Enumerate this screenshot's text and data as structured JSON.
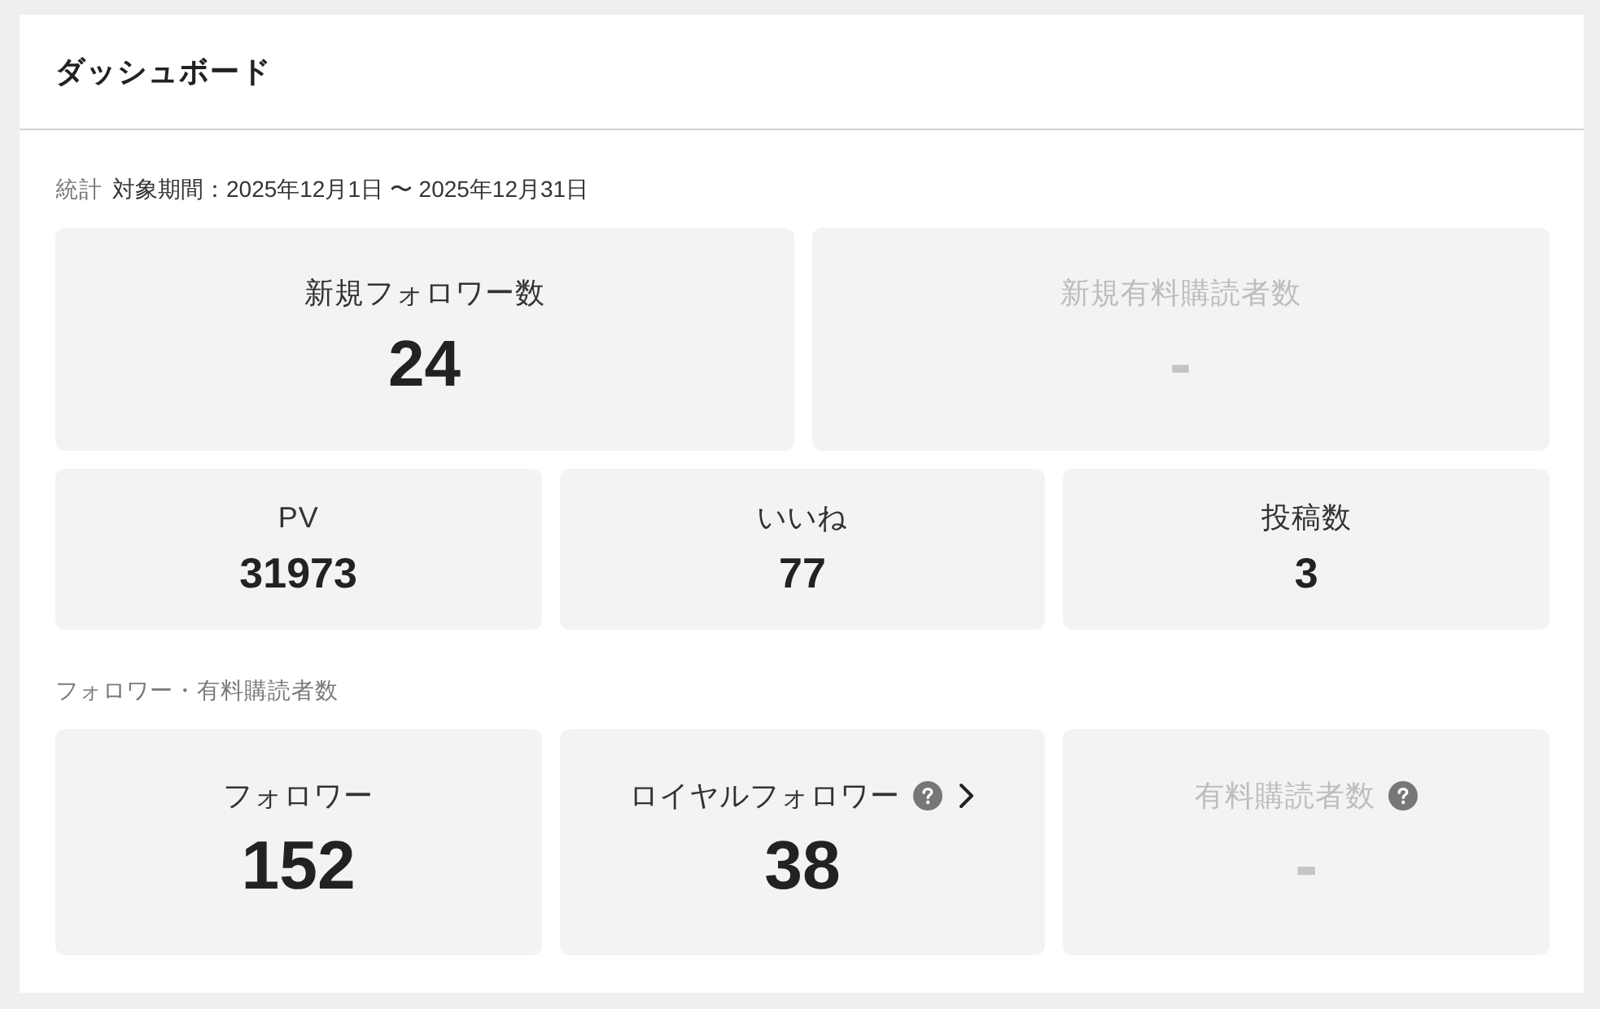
{
  "header": {
    "title": "ダッシュボード"
  },
  "sections": [
    {
      "label": "統計",
      "period": "対象期間：2025年12月1日 〜 2025年12月31日",
      "rows": [
        {
          "kind": "large",
          "tiles": [
            {
              "label": "新規フォロワー数",
              "value": "24",
              "disabled": false,
              "help": false,
              "link": false
            },
            {
              "label": "新規有料購読者数",
              "value": "-",
              "disabled": true,
              "help": false,
              "link": false
            }
          ]
        },
        {
          "kind": "compact",
          "tiles": [
            {
              "label": "PV",
              "value": "31973",
              "disabled": false,
              "help": false,
              "link": false
            },
            {
              "label": "いいね",
              "value": "77",
              "disabled": false,
              "help": false,
              "link": false
            },
            {
              "label": "投稿数",
              "value": "3",
              "disabled": false,
              "help": false,
              "link": false
            }
          ]
        }
      ]
    },
    {
      "label": "フォロワー・有料購読者数",
      "rows": [
        {
          "kind": "tall",
          "tiles": [
            {
              "label": "フォロワー",
              "value": "152",
              "disabled": false,
              "help": false,
              "link": false
            },
            {
              "label": "ロイヤルフォロワー",
              "value": "38",
              "disabled": false,
              "help": true,
              "link": true
            },
            {
              "label": "有料購読者数",
              "value": "-",
              "disabled": true,
              "help": true,
              "link": false
            }
          ]
        }
      ]
    }
  ]
}
